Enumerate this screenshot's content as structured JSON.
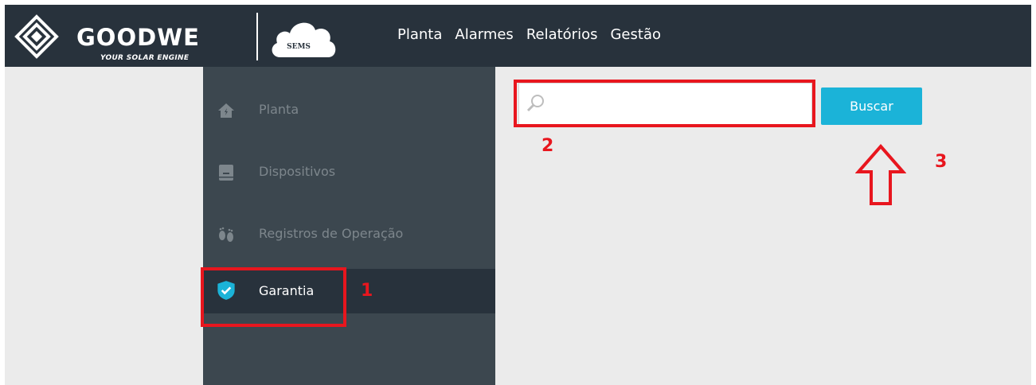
{
  "header": {
    "brand": "GOODWE",
    "tagline": "YOUR SOLAR ENGINE",
    "product": "SEMS",
    "nav": [
      {
        "label": "Planta"
      },
      {
        "label": "Alarmes"
      },
      {
        "label": "Relatórios"
      },
      {
        "label": "Gestão"
      }
    ]
  },
  "sidebar": {
    "items": [
      {
        "label": "Planta",
        "icon": "home-icon"
      },
      {
        "label": "Dispositivos",
        "icon": "device-icon"
      },
      {
        "label": "Registros de Operação",
        "icon": "footprints-icon"
      },
      {
        "label": "Garantia",
        "icon": "shield-check-icon",
        "active": true
      }
    ]
  },
  "search": {
    "value": "",
    "placeholder": "",
    "button_label": "Buscar"
  },
  "annotations": {
    "step1": "1",
    "step2": "2",
    "step3": "3"
  },
  "colors": {
    "header_bg": "#28323c",
    "sidebar_bg": "#3c474f",
    "accent": "#1bb3d8",
    "annotation": "#e8161e",
    "content_bg": "#ebebeb"
  }
}
